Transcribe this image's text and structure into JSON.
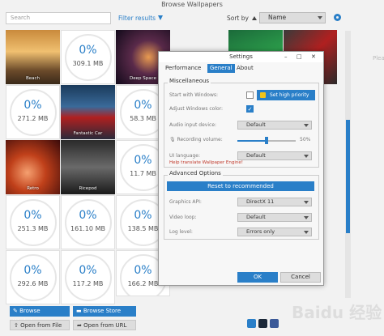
{
  "window": {
    "title": "Browse Wallpapers"
  },
  "toolbar": {
    "search_placeholder": "Search",
    "filter_label": "Filter results",
    "sort_label": "Sort by",
    "sort_value": "Name"
  },
  "tiles": [
    {
      "type": "image",
      "label": "Beach"
    },
    {
      "type": "progress",
      "percent": "0%",
      "size": "309.1 MB"
    },
    {
      "type": "image",
      "label": "Deep Space"
    },
    {
      "type": "image",
      "label": ""
    },
    {
      "type": "image",
      "label": ""
    },
    {
      "type": "progress",
      "percent": "0%",
      "size": "271.2 MB"
    },
    {
      "type": "image",
      "label": "Fantastic Car"
    },
    {
      "type": "progress",
      "percent": "0%",
      "size": "58.3 MB"
    },
    {
      "type": "image",
      "label": "Retro"
    },
    {
      "type": "image",
      "label": "Ricepod"
    },
    {
      "type": "progress",
      "percent": "0%",
      "size": "11.7 MB"
    },
    {
      "type": "progress",
      "percent": "0%",
      "size": "251.3 MB"
    },
    {
      "type": "progress",
      "percent": "0%",
      "size": "161.10 MB"
    },
    {
      "type": "progress",
      "percent": "0%",
      "size": "138.5 MB"
    },
    {
      "type": "progress",
      "percent": "0%",
      "size": "292.6 MB"
    },
    {
      "type": "progress",
      "percent": "0%",
      "size": "117.2 MB"
    },
    {
      "type": "progress",
      "percent": "0%",
      "size": "166.2 MB"
    }
  ],
  "side_hint": "Plea",
  "footer": {
    "browse_workshop": "Browse Workshop",
    "browse_store": "Browse Store",
    "open_file": "Open from File",
    "open_url": "Open from URL"
  },
  "watermark": "Baidu 经验",
  "dialog": {
    "title": "Settings",
    "tabs": [
      "Performance",
      "General",
      "About"
    ],
    "misc_title": "Miscellaneous",
    "start_with_windows": "Start with Windows:",
    "set_high_priority": "Set high priority",
    "adjust_color": "Adjust Windows color:",
    "audio_input": "Audio input device:",
    "audio_input_value": "Default",
    "recording_volume": "Recording volume:",
    "recording_volume_value": "50%",
    "recording_volume_level": 0.5,
    "ui_language": "UI language:",
    "ui_language_value": "Default",
    "help_translate": "Help translate Wallpaper Engine!",
    "advanced_title": "Advanced Options",
    "reset_label": "Reset to recommended",
    "graphics_api": "Graphics API:",
    "graphics_api_value": "DirectX 11",
    "video_loop": "Video loop:",
    "video_loop_value": "Default",
    "log_level": "Log level:",
    "log_level_value": "Errors only",
    "ok": "OK",
    "cancel": "Cancel",
    "min_glyph": "–",
    "max_glyph": "□",
    "close_glyph": "✕"
  },
  "colors": {
    "accent": "#2a7fc8",
    "link": "#c0392b"
  }
}
